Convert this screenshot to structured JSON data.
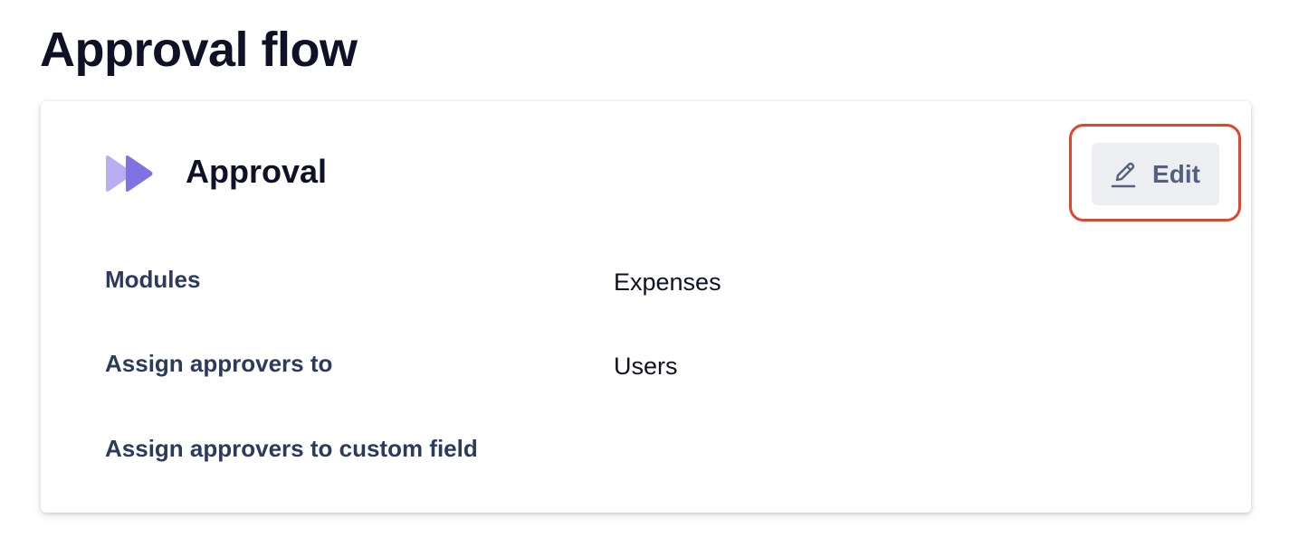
{
  "page": {
    "title": "Approval flow"
  },
  "card": {
    "title": "Approval",
    "icon": "double-chevron-right-icon",
    "edit_button": {
      "label": "Edit",
      "icon": "pencil-icon"
    },
    "fields": [
      {
        "label": "Modules",
        "value": "Expenses"
      },
      {
        "label": "Assign approvers to",
        "value": "Users"
      },
      {
        "label": "Assign approvers to custom field",
        "value": ""
      }
    ]
  },
  "colors": {
    "title_text": "#0f1226",
    "label_text": "#2c3b5c",
    "icon_light": "#b8aef0",
    "icon_dark": "#7f72e2",
    "edit_bg": "#eceef2",
    "edit_text": "#55607c",
    "highlight": "#e1452b"
  }
}
